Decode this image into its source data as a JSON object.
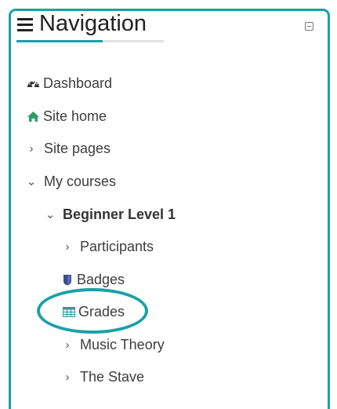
{
  "nav": {
    "title": "Navigation",
    "items": [
      {
        "label": "Dashboard",
        "icon": "dashboard-icon"
      },
      {
        "label": "Site home",
        "icon": "home-icon"
      },
      {
        "label": "Site pages",
        "icon": "chevron-right-icon"
      },
      {
        "label": "My courses",
        "icon": "chevron-down-icon"
      },
      {
        "label": "Beginner Level 1",
        "icon": "chevron-down-icon"
      },
      {
        "label": "Participants",
        "icon": "chevron-right-icon"
      },
      {
        "label": "Badges",
        "icon": "badge-icon"
      },
      {
        "label": "Grades",
        "icon": "table-icon"
      },
      {
        "label": "Music Theory",
        "icon": "chevron-right-icon"
      },
      {
        "label": "The Stave",
        "icon": "chevron-right-icon"
      }
    ]
  },
  "colors": {
    "accent": "#1aa0a8",
    "dashboard_icon": "#333333",
    "home_icon": "#2e9c6a",
    "badge_icon": "#3a4a8a",
    "grades_icon": "#2a9da8"
  }
}
